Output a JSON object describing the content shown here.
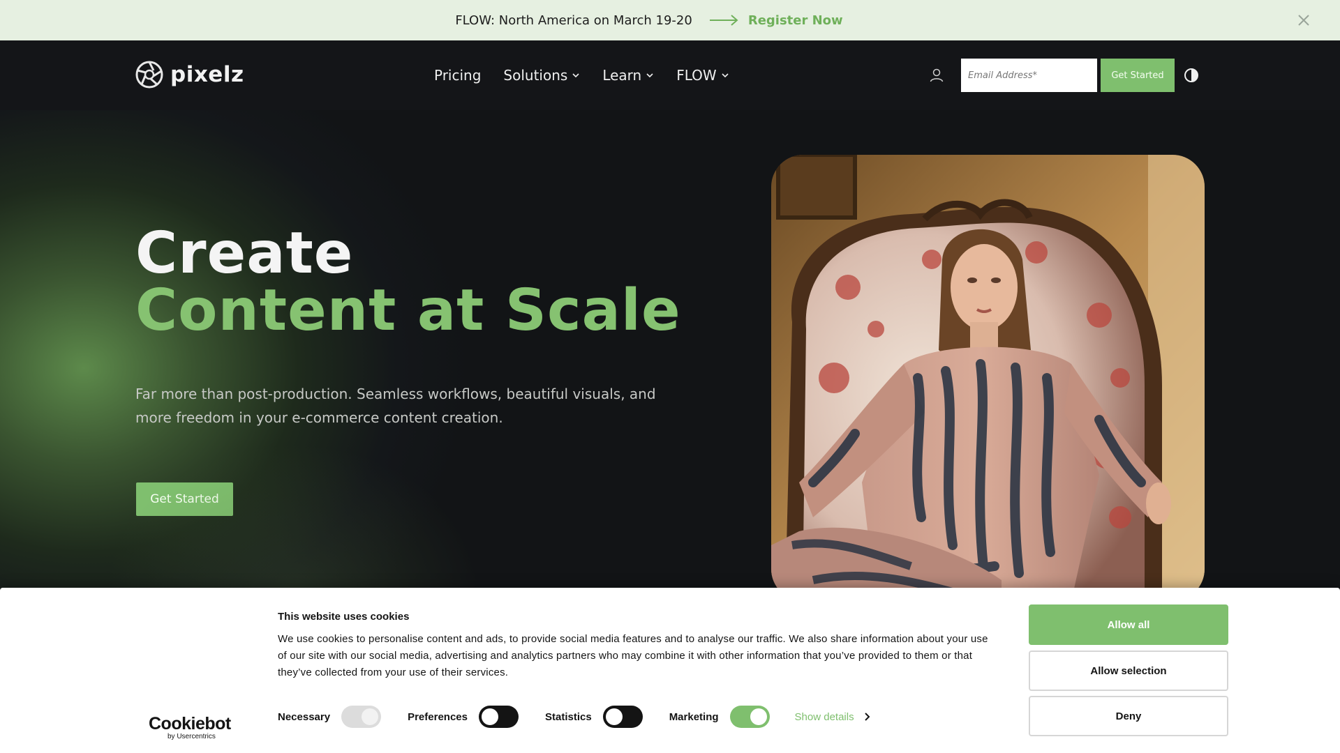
{
  "announcement": {
    "text": "FLOW: North America on March 19-20",
    "link_label": "Register Now"
  },
  "header": {
    "logo_text": "pixelz",
    "nav": [
      {
        "label": "Pricing",
        "has_dropdown": false
      },
      {
        "label": "Solutions",
        "has_dropdown": true
      },
      {
        "label": "Learn",
        "has_dropdown": true
      },
      {
        "label": "FLOW",
        "has_dropdown": true
      }
    ],
    "email_placeholder": "Email Address*",
    "email_value": "",
    "cta_label": "Get Started"
  },
  "hero": {
    "title_line1": "Create",
    "title_line2": "Content at Scale",
    "subtitle": "Far more than post-production. Seamless workflows, beautiful visuals, and more freedom in your e-commerce content creation.",
    "cta_label": "Get Started"
  },
  "cookie_banner": {
    "logo_main": "Cookiebot",
    "logo_sub": "by Usercentrics",
    "title": "This website uses cookies",
    "text": "We use cookies to personalise content and ads, to provide social media features and to analyse our traffic. We also share information about your use of our site with our social media, advertising and analytics partners who may combine it with other information that you’ve provided to them or that they’ve collected from your use of their services.",
    "toggles": [
      {
        "label": "Necessary",
        "state": "on",
        "disabled": true
      },
      {
        "label": "Preferences",
        "state": "off",
        "disabled": false
      },
      {
        "label": "Statistics",
        "state": "off",
        "disabled": false
      },
      {
        "label": "Marketing",
        "state": "on",
        "disabled": false
      }
    ],
    "show_details_label": "Show details",
    "buttons": {
      "allow_all": "Allow all",
      "allow_selection": "Allow selection",
      "deny": "Deny"
    }
  },
  "colors": {
    "accent_green": "#7fbf6e",
    "title_green": "#86c271",
    "announcement_bg": "#e6f0e1",
    "header_bg": "#141518",
    "dark_bg": "#121416"
  },
  "icons": {
    "announcement_arrow": "arrow-right-icon",
    "announcement_close": "close-icon",
    "logo_mark": "aperture-logo-icon",
    "nav_dropdown": "chevron-down-icon",
    "account": "user-icon",
    "theme": "contrast-icon",
    "show_details": "chevron-right-icon"
  }
}
